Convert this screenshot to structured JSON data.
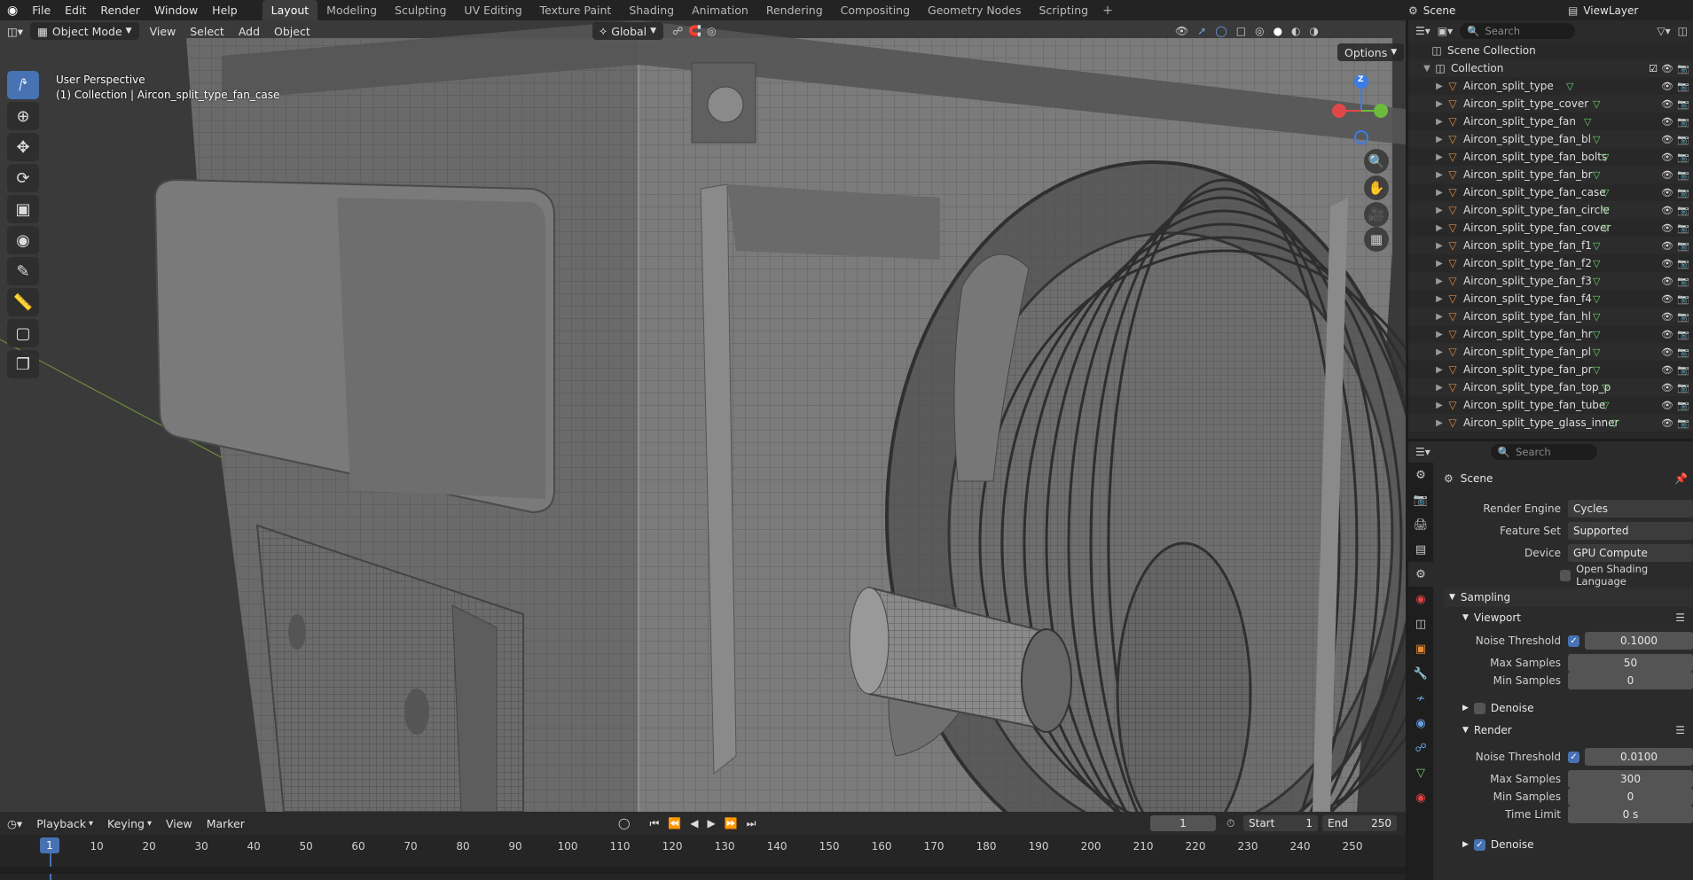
{
  "app_menu": [
    "File",
    "Edit",
    "Render",
    "Window",
    "Help"
  ],
  "workspaces": [
    "Layout",
    "Modeling",
    "Sculpting",
    "UV Editing",
    "Texture Paint",
    "Shading",
    "Animation",
    "Rendering",
    "Compositing",
    "Geometry Nodes",
    "Scripting"
  ],
  "active_workspace": "Layout",
  "scene": "Scene",
  "view_layer": "ViewLayer",
  "viewport": {
    "mode": "Object Mode",
    "menus": [
      "View",
      "Select",
      "Add",
      "Object"
    ],
    "orientation": "Global",
    "options": "Options",
    "overlay_title": "User Perspective",
    "overlay_subtitle": "(1) Collection | Aircon_split_type_fan_case",
    "gizmo_z": "Z"
  },
  "outliner": {
    "search_placeholder": "Search",
    "root": "Scene Collection",
    "collection": "Collection",
    "objects": [
      "Aircon_split_type",
      "Aircon_split_type_cover",
      "Aircon_split_type_fan",
      "Aircon_split_type_fan_bl",
      "Aircon_split_type_fan_bolts",
      "Aircon_split_type_fan_br",
      "Aircon_split_type_fan_case",
      "Aircon_split_type_fan_circle",
      "Aircon_split_type_fan_cover",
      "Aircon_split_type_fan_f1",
      "Aircon_split_type_fan_f2",
      "Aircon_split_type_fan_f3",
      "Aircon_split_type_fan_f4",
      "Aircon_split_type_fan_hl",
      "Aircon_split_type_fan_hr",
      "Aircon_split_type_fan_pl",
      "Aircon_split_type_fan_pr",
      "Aircon_split_type_fan_top_p",
      "Aircon_split_type_fan_tube",
      "Aircon_split_type_glass_inner"
    ]
  },
  "properties": {
    "search_placeholder": "Search",
    "context": "Scene",
    "render_engine_label": "Render Engine",
    "render_engine": "Cycles",
    "feature_set_label": "Feature Set",
    "feature_set": "Supported",
    "device_label": "Device",
    "device": "GPU Compute",
    "osl_label": "Open Shading Language",
    "sampling": "Sampling",
    "viewport": "Viewport",
    "render": "Render",
    "noise_threshold_label": "Noise Threshold",
    "max_samples_label": "Max Samples",
    "min_samples_label": "Min Samples",
    "time_limit_label": "Time Limit",
    "vp_noise": "0.1000",
    "vp_max": "50",
    "vp_min": "0",
    "denoise": "Denoise",
    "r_noise": "0.0100",
    "r_max": "300",
    "r_min": "0",
    "r_time": "0 s"
  },
  "timeline": {
    "menus": [
      "Playback",
      "Keying",
      "View",
      "Marker"
    ],
    "current_frame": "1",
    "start_label": "Start",
    "start": "1",
    "end_label": "End",
    "end": "250",
    "ticks": [
      "1",
      "10",
      "20",
      "30",
      "40",
      "50",
      "60",
      "70",
      "80",
      "90",
      "100",
      "110",
      "120",
      "130",
      "140",
      "150",
      "160",
      "170",
      "180",
      "190",
      "200",
      "210",
      "220",
      "230",
      "240",
      "250"
    ]
  }
}
